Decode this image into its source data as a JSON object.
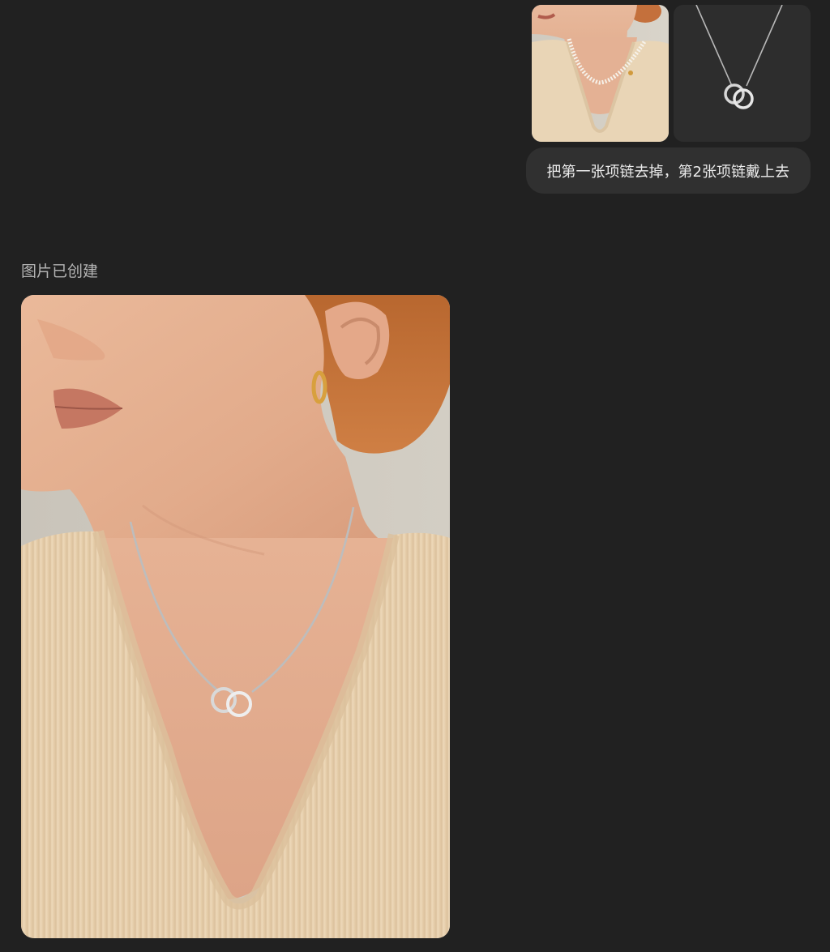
{
  "conversation": {
    "user_message": {
      "attachments": [
        {
          "name": "first-necklace-photo"
        },
        {
          "name": "second-necklace-photo"
        }
      ],
      "text": "把第一张项链去掉，第2张项链戴上去"
    },
    "assistant_message": {
      "status": "图片已创建"
    }
  },
  "colors": {
    "background": "#212121",
    "bubble": "#303030",
    "text": "#ececec",
    "muted_text": "#b4b4b4"
  }
}
